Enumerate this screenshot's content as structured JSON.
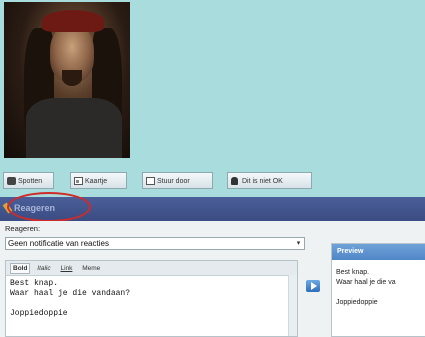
{
  "profile": {
    "photo_alt": "profile photo"
  },
  "actions": [
    {
      "label": "Spotten",
      "icon": "message-icon"
    },
    {
      "label": "Kaartje",
      "icon": "card-icon"
    },
    {
      "label": "Stuur door",
      "icon": "forward-icon"
    },
    {
      "label": "Dit is niet OK",
      "icon": "report-icon"
    }
  ],
  "section": {
    "title": "Reageren"
  },
  "reply": {
    "options_label": "Reageren:",
    "notification_selected": "Geen notificatie van reacties",
    "toolbar": {
      "bold": "Bold",
      "italic": "Italic",
      "link": "Link",
      "meme": "Meme"
    },
    "text": "Best knap.\nWaar haal je die vandaan?\n\nJoppiedoppie"
  },
  "preview": {
    "title": "Preview",
    "text": "Best knap.\nWaar haal je die va\n\nJoppiedoppie"
  },
  "colors": {
    "background": "#a9dcdc",
    "section_bar": "#3b4c82",
    "highlight_ring": "#d12a2a",
    "preview_header": "#4f86c6"
  }
}
